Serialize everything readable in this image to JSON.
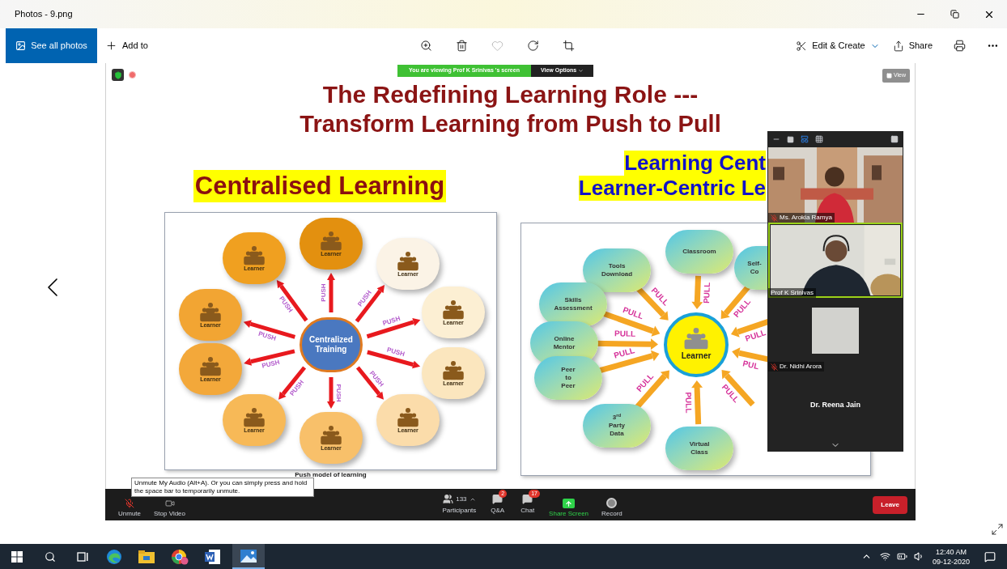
{
  "window": {
    "title": "Photos - 9.png"
  },
  "toolbar": {
    "see_all": "See all photos",
    "add_to": "Add to",
    "edit_create": "Edit & Create",
    "share": "Share"
  },
  "banner": {
    "text": "You are viewing Prof K Srinivas 's screen",
    "view_options": "View Options"
  },
  "view_button": "View",
  "slide": {
    "title": [
      "The Redefining Learning Role ---",
      "Transform Learning from Push to Pull"
    ],
    "left_heading": "Centralised Learning",
    "push_diagram": {
      "center": "Centralized Training",
      "nodes": [
        {
          "label": "Learner",
          "arrow_label": "PUSH",
          "color": "#e3900f"
        },
        {
          "label": "Learner",
          "arrow_label": "PUSH",
          "color": "#f0a020"
        },
        {
          "label": "Learner",
          "arrow_label": "PUSH",
          "color": "#fbf3e6"
        },
        {
          "label": "Learner",
          "arrow_label": "PUSH",
          "color": "#f2a533"
        },
        {
          "label": "Learner",
          "arrow_label": "PUSH",
          "color": "#fcefd3"
        },
        {
          "label": "Learner",
          "arrow_label": "PUSH",
          "color": "#f3a83a"
        },
        {
          "label": "Learner",
          "arrow_label": "PUSH",
          "color": "#fbe6be"
        },
        {
          "label": "Learner",
          "arrow_label": "PUSH",
          "color": "#f7b957"
        },
        {
          "label": "Learner",
          "arrow_label": "PUSH",
          "color": "#fbdcaa"
        },
        {
          "label": "Learner",
          "arrow_label": "PUSH",
          "color": "#f8c06a"
        }
      ]
    },
    "left_caption": "Push model of learning",
    "right_heading": [
      "Learning Cent",
      "Learner-Centric Le"
    ],
    "pull_diagram": {
      "center": "Learner",
      "nodes": [
        {
          "label": "Classroom"
        },
        {
          "label": "Tools Download"
        },
        {
          "label": "Skills Assessment"
        },
        {
          "label": "Online Mentor"
        },
        {
          "label": "Peer to Peer"
        },
        {
          "label": "3$^{rd}$ Party Data"
        },
        {
          "label": "Virtual Class"
        },
        {
          "label": "Self- Co"
        }
      ],
      "arrows": [
        {
          "label": "PULL"
        },
        {
          "label": "PULL"
        },
        {
          "label": "PULL"
        },
        {
          "label": "PULL"
        },
        {
          "label": "PULL"
        },
        {
          "label": "PULL"
        },
        {
          "label": "PULL"
        },
        {
          "label": "PULL"
        },
        {
          "label": "PULL"
        },
        {
          "label": "PUL"
        },
        {
          "label": "PULL"
        }
      ]
    }
  },
  "participants": {
    "tiles": [
      {
        "name": "Ms. Arokia Ramya",
        "kind": "video",
        "muted": true,
        "selected": false
      },
      {
        "name": "Prof K Srinivas",
        "kind": "video",
        "muted": false,
        "selected": true
      },
      {
        "name": "Dr. Nidhi Arora",
        "kind": "avatar",
        "muted": true,
        "selected": false
      },
      {
        "name": "Dr. Reena Jain",
        "kind": "name",
        "muted": false,
        "selected": false
      }
    ]
  },
  "meeting_toolbar": {
    "unmute": "Unmute",
    "stop_video": "Stop Video",
    "participants_count": "133",
    "participants": "Participants",
    "qa": "Q&A",
    "qa_badge": "2",
    "chat": "Chat",
    "chat_badge": "17",
    "share_screen": "Share Screen",
    "record": "Record",
    "leave": "Leave"
  },
  "tooltip": "Unmute My Audio (Alt+A). Or you can simply press and hold the space bar to temporarily unmute.",
  "taskbar": {
    "time": "12:40 AM",
    "date": "09-12-2020"
  }
}
